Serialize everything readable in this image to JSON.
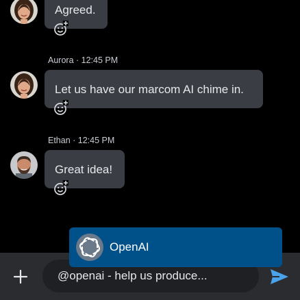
{
  "messages": [
    {
      "author": "",
      "time": "",
      "meta": "",
      "text": "Agreed.",
      "avatar_icon": "woman-avatar",
      "reaction_icon": "add-reaction-icon"
    },
    {
      "author": "Aurora",
      "time": "12:45 PM",
      "meta": "Aurora · 12:45 PM",
      "text": "Let us have our marcom AI chime in.",
      "avatar_icon": "woman-avatar",
      "reaction_icon": "add-reaction-icon"
    },
    {
      "author": "Ethan",
      "time": "12:45 PM",
      "meta": "Ethan · 12:45 PM",
      "text": "Great idea!",
      "avatar_icon": "man-avatar",
      "reaction_icon": "add-reaction-icon"
    }
  ],
  "mention_popup": {
    "name": "OpenAI",
    "icon": "openai-logo-icon",
    "bg_color": "#005189"
  },
  "composer": {
    "value": "@openai - help us produce...",
    "add_icon": "plus-icon",
    "send_icon": "send-icon",
    "accent_color": "#4aa3e8"
  }
}
